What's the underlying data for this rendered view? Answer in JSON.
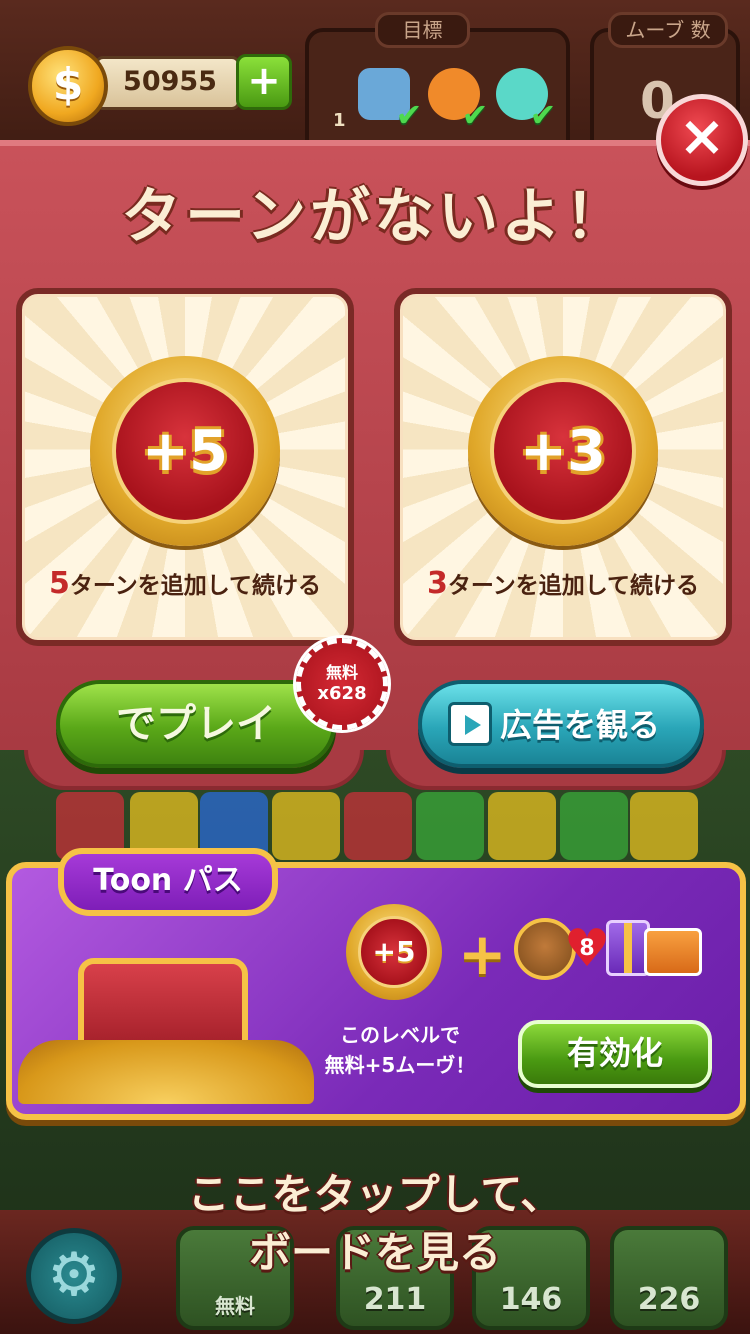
{
  "hud": {
    "coins": "50955",
    "coin_symbol": "$",
    "add_coins_symbol": "+",
    "goal_title": "目標",
    "goal_count": "1",
    "moves_title": "ムーブ 数",
    "moves_value": "0"
  },
  "modal": {
    "title": "ターンがないよ！",
    "close_symbol": "×",
    "options": [
      {
        "badge": "+5",
        "num": "5",
        "text": "ターンを追加して続ける"
      },
      {
        "badge": "+3",
        "num": "3",
        "text": "ターンを追加して続ける"
      }
    ],
    "play_button": "でプレイ",
    "free_badge_line1": "無料",
    "free_badge_line2": "x628",
    "ad_button": "広告を観る"
  },
  "toon_pass": {
    "tab_label": "Toon パス",
    "medal": "+5",
    "plus": "+",
    "heart_count": "8",
    "description_line1": "このレベルで",
    "description_line2": "無料+5ムーヴ！",
    "activate_button": "有効化"
  },
  "hint": {
    "line1": "ここをタップして、",
    "line2": "ボードを見る"
  },
  "toolbar": {
    "settings_symbol": "⚙",
    "boosters": [
      {
        "name": "hammer",
        "count": "無料"
      },
      {
        "name": "glove",
        "count": "211"
      },
      {
        "name": "bomb",
        "count": "146"
      },
      {
        "name": "dice",
        "count": "226"
      }
    ]
  },
  "colors": {
    "modal_red": "#c9525a",
    "gold": "#f6c246",
    "green_button": "#5aa818",
    "teal_button": "#2aa6b8",
    "purple_pass": "#7a2ab8"
  }
}
